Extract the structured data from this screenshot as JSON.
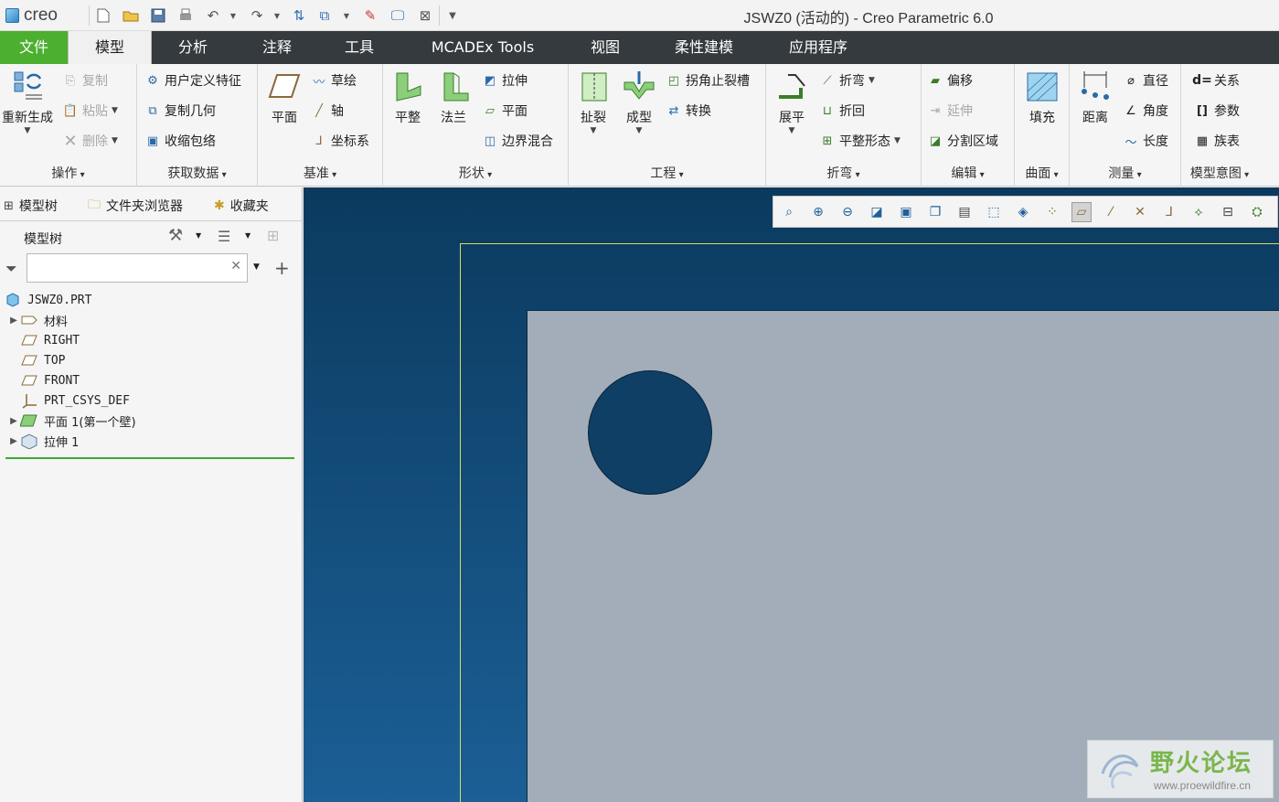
{
  "app": {
    "logo_text": "creo",
    "window_title": "JSWZ0 (活动的) - Creo Parametric 6.0"
  },
  "quick_access": [
    "new-icon",
    "open-icon",
    "save-icon",
    "print-icon",
    "undo-icon",
    "redo-icon",
    "regenerate-icon",
    "windows-icon",
    "erase-icon",
    "display-icon",
    "close-window-icon",
    "customize-icon"
  ],
  "tabs": [
    {
      "label": "文件"
    },
    {
      "label": "模型"
    },
    {
      "label": "分析"
    },
    {
      "label": "注释"
    },
    {
      "label": "工具"
    },
    {
      "label": "MCADEx Tools"
    },
    {
      "label": "视图"
    },
    {
      "label": "柔性建模"
    },
    {
      "label": "应用程序"
    }
  ],
  "ribbon": {
    "operations": {
      "label": "操作",
      "regenerate": "重新生成",
      "copy": "复制",
      "paste": "粘贴",
      "delete": "删除"
    },
    "get_data": {
      "label": "获取数据",
      "udf": "用户定义特征",
      "copy_geom": "复制几何",
      "shrinkwrap": "收缩包络"
    },
    "datum": {
      "label": "基准",
      "plane": "平面",
      "sketch": "草绘",
      "axis": "轴",
      "csys": "坐标系"
    },
    "shapes": {
      "label": "形状",
      "flat": "平整",
      "flange": "法兰",
      "extrude": "拉伸",
      "planar": "平面",
      "boundary_blend": "边界混合"
    },
    "engineering": {
      "label": "工程",
      "rip": "扯裂",
      "form": "成型",
      "corner_relief": "拐角止裂槽",
      "convert": "转换"
    },
    "bends": {
      "label": "折弯",
      "unbend": "展平",
      "bend": "折弯",
      "bend_back": "折回",
      "flat_state": "平整形态"
    },
    "editing": {
      "label": "编辑",
      "offset": "偏移",
      "extend": "延伸",
      "split_area": "分割区域"
    },
    "surfaces": {
      "label": "曲面",
      "fill": "填充"
    },
    "measure": {
      "label": "测量",
      "distance": "距离",
      "diameter": "直径",
      "angle": "角度",
      "length": "长度"
    },
    "model_intent": {
      "label": "模型意图",
      "relations": "关系",
      "parameters": "参数",
      "family_table": "族表"
    }
  },
  "left_panel": {
    "tabs": [
      {
        "label": "模型树"
      },
      {
        "label": "文件夹浏览器"
      },
      {
        "label": "收藏夹"
      }
    ],
    "header": "模型树",
    "search": {
      "value": "",
      "placeholder": ""
    },
    "tree": [
      {
        "label": "JSWZ0.PRT"
      },
      {
        "label": "材料"
      },
      {
        "label": "RIGHT"
      },
      {
        "label": "TOP"
      },
      {
        "label": "FRONT"
      },
      {
        "label": "PRT_CSYS_DEF"
      },
      {
        "label": "平面 1(第一个壁)"
      },
      {
        "label": "拉伸 1"
      }
    ]
  },
  "view_toolbar": [
    "zoom-refit-icon",
    "zoom-in-icon",
    "zoom-out-icon",
    "repaint-icon",
    "display-style-icon",
    "saved-views-icon",
    "view-manager-icon",
    "perspective-icon",
    "section-icon",
    "plane-display-icon",
    "axis-display-icon",
    "point-display-icon",
    "csys-display-icon",
    "annotation-display-icon",
    "spin-center-icon",
    "appearance-icon"
  ],
  "watermark": {
    "title": "野火论坛",
    "url": "www.proewildfire.cn"
  },
  "colors": {
    "file_tab": "#4caf2f",
    "tabbar": "#353a3e",
    "canvas_top": "#0b3a5e",
    "canvas_bottom": "#1b5f96",
    "plate": "#a3adba",
    "hole": "#0f3f64",
    "frame_edge": "#d4e060"
  }
}
